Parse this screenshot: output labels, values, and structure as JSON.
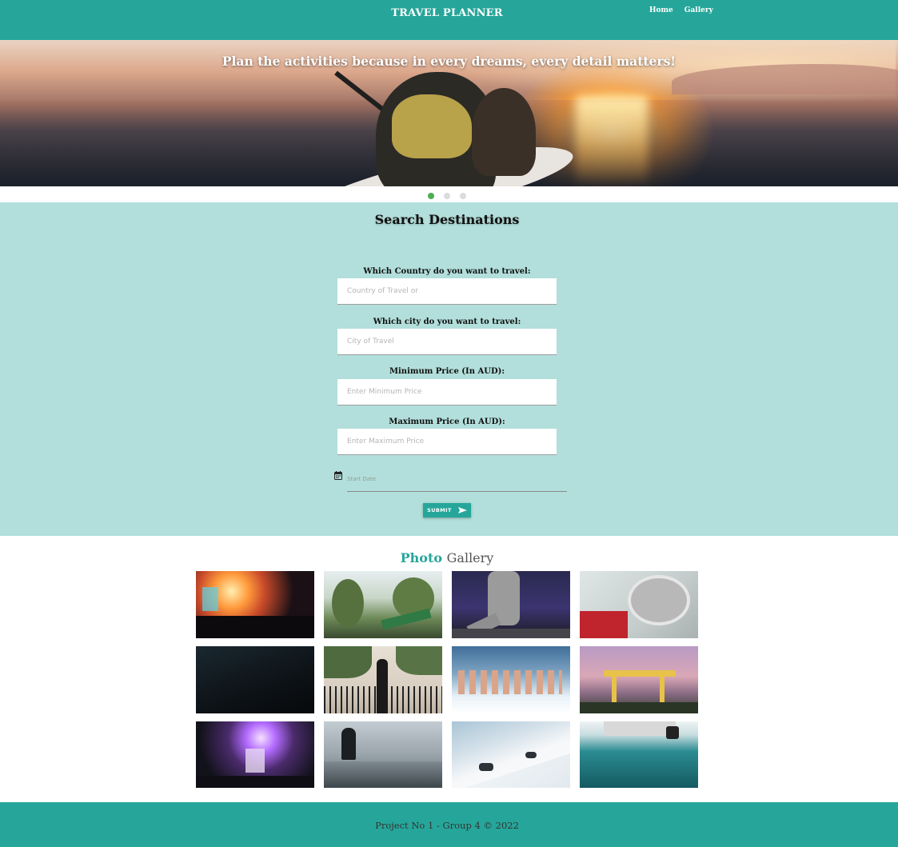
{
  "header": {
    "brand": "TRAVEL PLANNER",
    "nav": [
      {
        "label": "Home"
      },
      {
        "label": "Gallery"
      }
    ],
    "color": "#26a69a"
  },
  "hero": {
    "caption": "Plan the activities because in every dreams, every detail matters!",
    "slides": 3,
    "active_slide": 1
  },
  "search": {
    "title": "Search Destinations",
    "background": "#b2dfdb",
    "fields": [
      {
        "label": "Which Country do you want to travel:",
        "placeholder": "Country of Travel or"
      },
      {
        "label": "Which city do you want to travel:",
        "placeholder": "City of Travel"
      },
      {
        "label": "Minimum Price (In AUD):",
        "placeholder": "Enter Minimum Price"
      },
      {
        "label": "Maximum Price (In AUD):",
        "placeholder": "Enter Maximum Price"
      }
    ],
    "start_date_placeholder": "Start Date",
    "date_icon": "calendar-icon",
    "submit_label": "SUBMIT",
    "submit_icon": "send-icon"
  },
  "gallery": {
    "title_part1": "Photo",
    "title_part2": "Gallery",
    "photos": [
      "concert-crowd-lights",
      "palm-trees-street-sign",
      "dancer-on-stage",
      "brass-instrument",
      "dark-cave",
      "woman-at-gate",
      "swimmers-on-ice",
      "cranes-at-sunset",
      "dj-stage-lights",
      "kayaker-on-lake",
      "snowboarders-on-slope",
      "boat-on-ocean"
    ]
  },
  "footer": {
    "text": "Project No 1 - Group 4 © 2022"
  }
}
